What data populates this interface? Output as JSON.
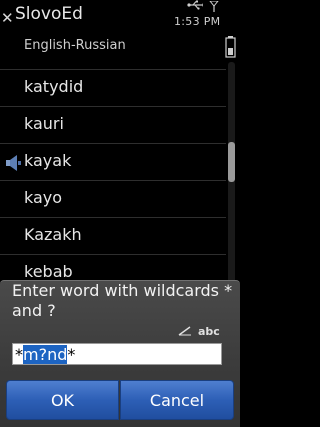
{
  "status": {
    "app_title": "SlovoEd",
    "time": "1:53 PM"
  },
  "dictionary": {
    "label": "English-Russian"
  },
  "words": [
    {
      "text": "katydid"
    },
    {
      "text": "kauri"
    },
    {
      "text": "kayak"
    },
    {
      "text": "kayo"
    },
    {
      "text": "Kazakh"
    },
    {
      "text": "kebab"
    }
  ],
  "dialog": {
    "prompt": "Enter word with wildcards * and ?",
    "input_mode": "abc",
    "input_prefix": "*",
    "input_selected": "m?nd",
    "input_suffix": "*",
    "ok_label": "OK",
    "cancel_label": "Cancel"
  },
  "colors": {
    "button_blue": "#2d5fb6",
    "selection_blue": "#1d64c2"
  },
  "icons": [
    "close-icon",
    "usb-icon",
    "antenna-icon",
    "battery-icon",
    "speaker-icon",
    "pen-icon"
  ]
}
